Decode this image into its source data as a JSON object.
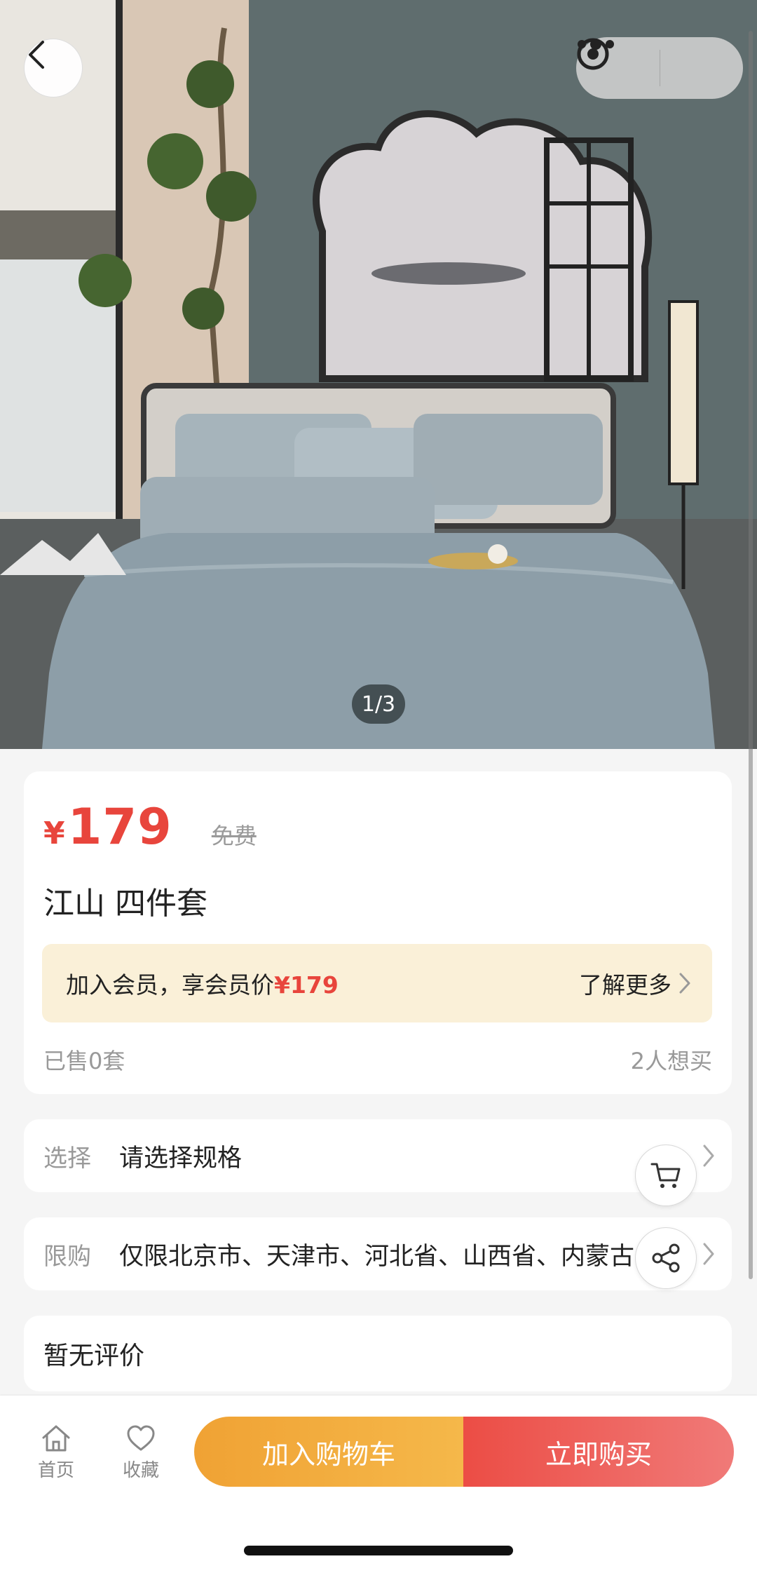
{
  "hero": {
    "pager_text": "1/3",
    "colors": {
      "wall": "#5f6d6e",
      "bedding": "#8d9ea8",
      "floor": "#5b5f5f"
    }
  },
  "product": {
    "currency": "¥",
    "price": "179",
    "original_price_label": "免费",
    "title": "江山 四件套",
    "member_prefix": "加入会员，享会员价",
    "member_price": "¥179",
    "learn_more": "了解更多",
    "sold": "已售0套",
    "wants": "2人想买"
  },
  "options": {
    "select_label": "选择",
    "select_value": "请选择规格",
    "limit_label": "限购",
    "limit_value": "仅限北京市、天津市、河北省、山西省、内蒙古"
  },
  "reviews": {
    "text": "暂无评价"
  },
  "bottom": {
    "home_label": "首页",
    "fav_label": "收藏",
    "add_cart_label": "加入购物车",
    "buy_now_label": "立即购买"
  },
  "colors": {
    "accent_red": "#e8453c",
    "cart_orange": "#f0a234",
    "member_bg": "#faf0d8"
  }
}
